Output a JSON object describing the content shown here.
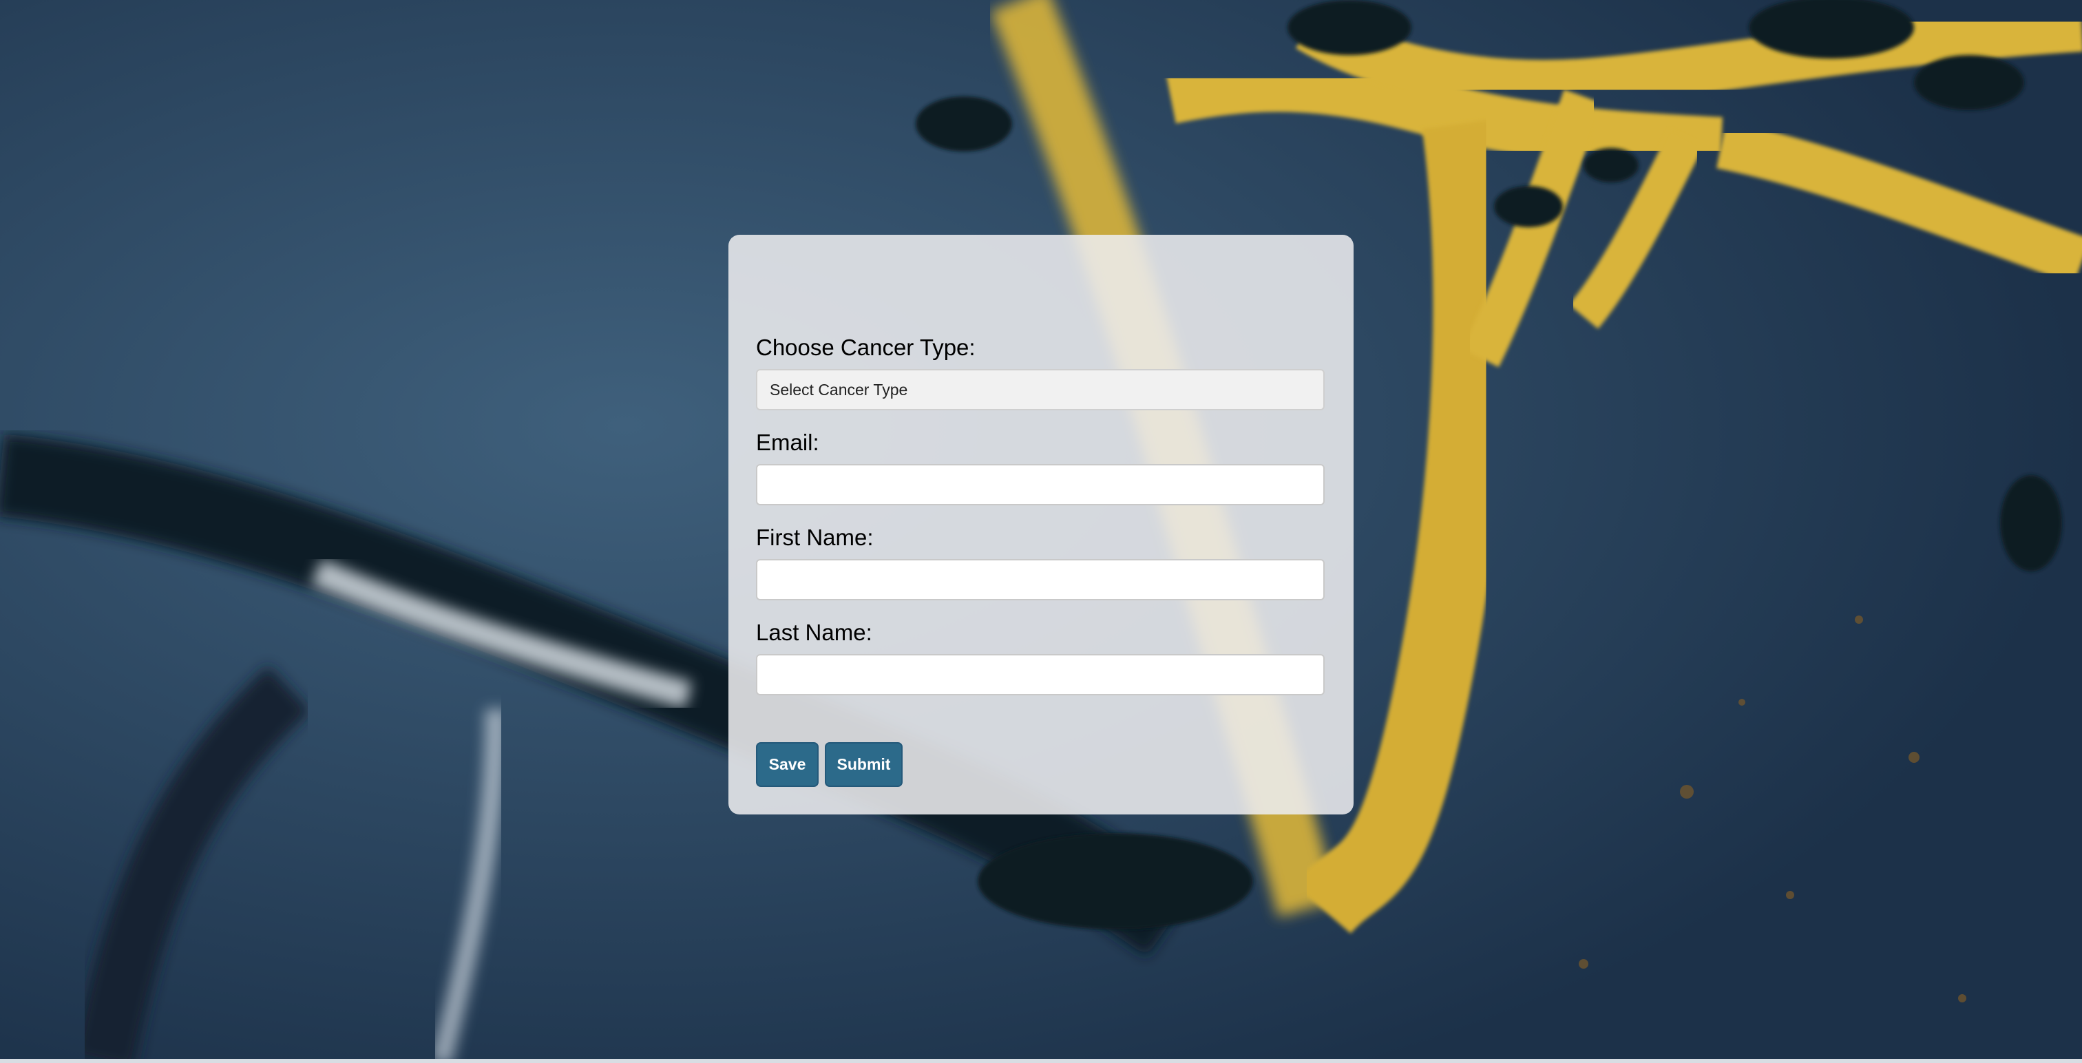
{
  "form": {
    "cancer_type_label": "Choose Cancer Type:",
    "cancer_type_selected": "Select Cancer Type",
    "email_label": "Email:",
    "email_value": "",
    "first_name_label": "First Name:",
    "first_name_value": "",
    "last_name_label": "Last Name:",
    "last_name_value": "",
    "save_label": "Save",
    "submit_label": "Submit"
  },
  "colors": {
    "background": "#2d4a66",
    "card": "#ececee",
    "button": "#2c6a8a",
    "button_text": "#ffffff",
    "accent_yellow": "#d9b43a"
  }
}
